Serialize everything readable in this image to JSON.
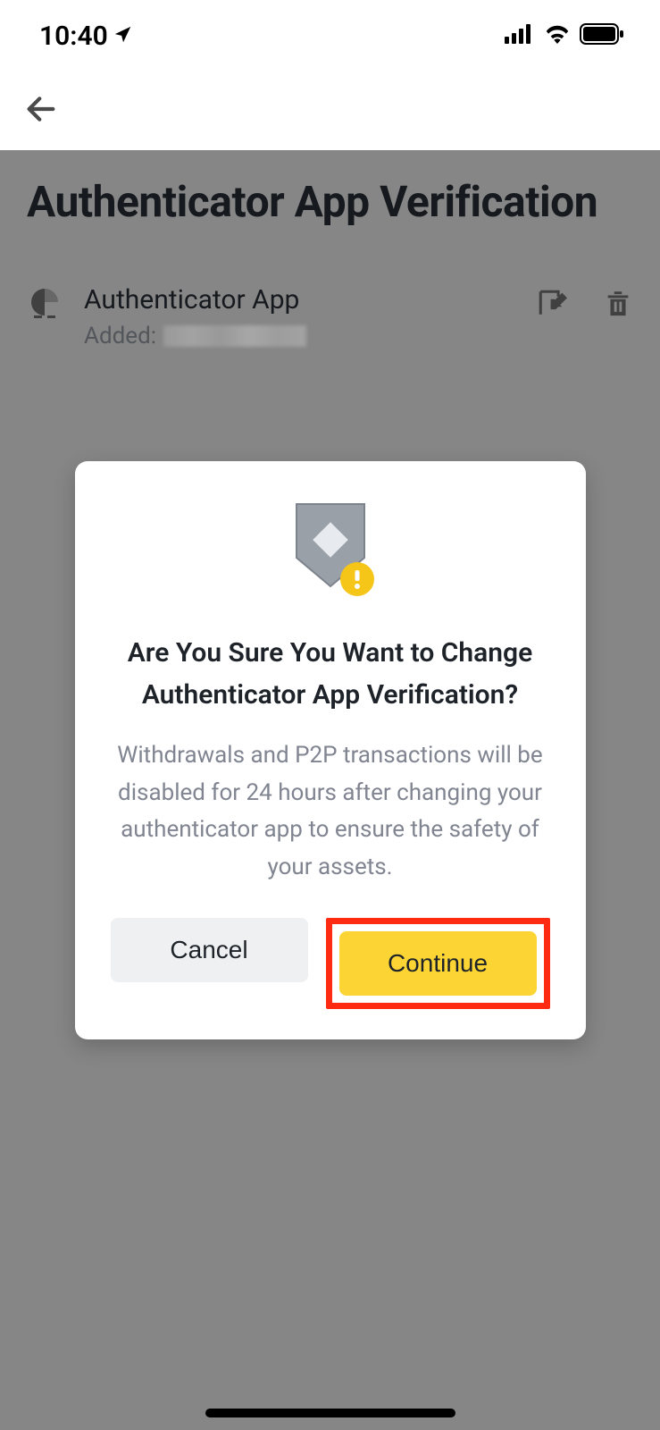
{
  "status": {
    "time": "10:40"
  },
  "page": {
    "title": "Authenticator App Verification"
  },
  "item": {
    "name": "Authenticator App",
    "added_label": "Added:"
  },
  "modal": {
    "title": "Are You Sure You Want to Change Authenticator App Verification?",
    "body": "Withdrawals and P2P transactions will be disabled for 24 hours after changing your authenticator app to ensure the safety of your assets.",
    "cancel": "Cancel",
    "continue": "Continue"
  }
}
